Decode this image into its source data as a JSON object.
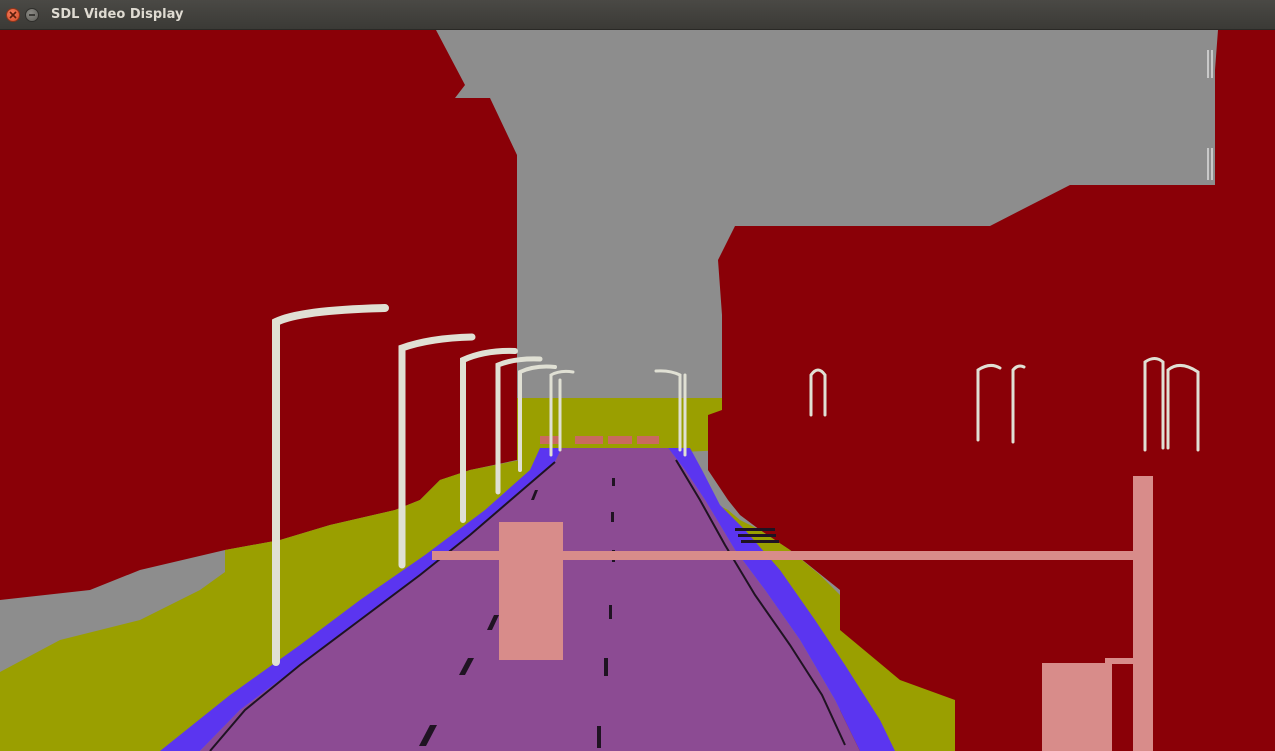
{
  "window": {
    "title": "SDL Video Display",
    "buttons": [
      {
        "name": "close",
        "icon": "close-icon"
      },
      {
        "name": "minimize",
        "icon": "minimize-icon"
      }
    ]
  },
  "display": {
    "content": "semantic-segmentation-render",
    "palette": {
      "building": "#8a0007",
      "sky": "#8d8d8d",
      "vegetation": "#9a9f00",
      "road": "#8c4b93",
      "lane_marking": "#1f1322",
      "sidewalk": "#5b35f0",
      "pole": "#e0e0d4",
      "traffic_sign": "#d88c8a"
    }
  }
}
